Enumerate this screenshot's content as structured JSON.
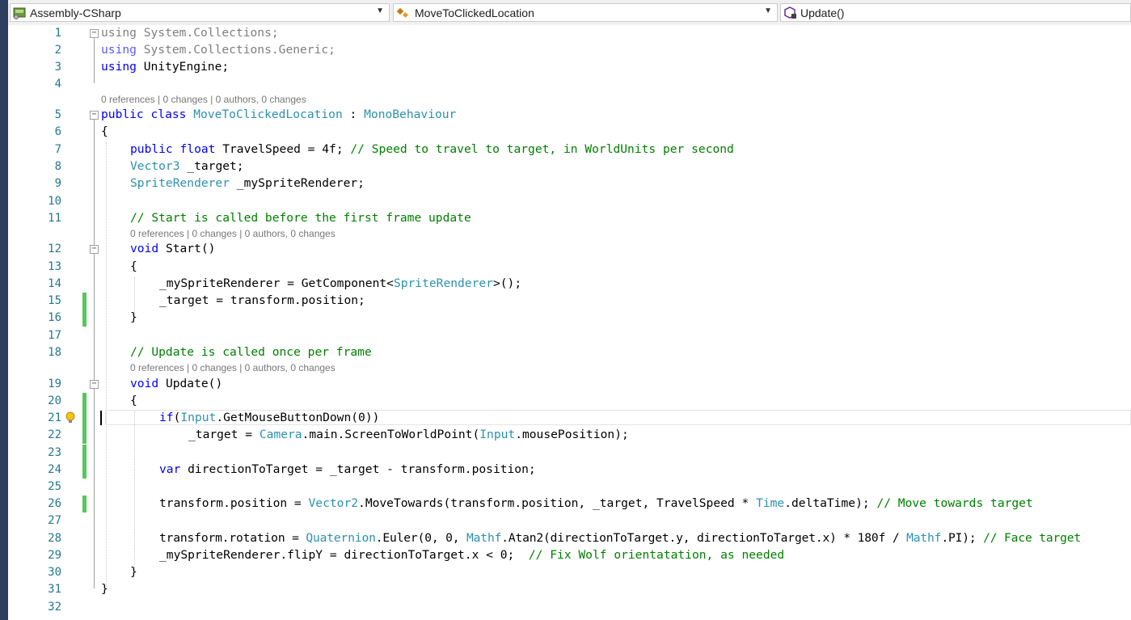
{
  "nav": {
    "project": "Assembly-CSharp",
    "type": "MoveToClickedLocation",
    "member": "Update()"
  },
  "lens": {
    "class": "0 references | 0 changes | 0 authors, 0 changes",
    "start": "0 references | 0 changes | 0 authors, 0 changes",
    "update": "0 references | 0 changes | 0 authors, 0 changes"
  },
  "line_numbers": [
    "1",
    "2",
    "3",
    "4",
    "5",
    "6",
    "7",
    "8",
    "9",
    "10",
    "11",
    "12",
    "13",
    "14",
    "15",
    "16",
    "17",
    "18",
    "19",
    "20",
    "21",
    "22",
    "23",
    "24",
    "25",
    "26",
    "27",
    "28",
    "29",
    "30",
    "31",
    "32"
  ],
  "code": {
    "l1": [
      "using",
      " System.Collections;"
    ],
    "l2": [
      "using",
      " System.Collections.Generic;"
    ],
    "l3": [
      "using",
      " UnityEngine;"
    ],
    "l5": [
      "public",
      " ",
      "class",
      " ",
      "MoveToClickedLocation",
      " : ",
      "MonoBehaviour"
    ],
    "l6": "{",
    "l7": [
      "public",
      " ",
      "float",
      " TravelSpeed = 4f; ",
      "// Speed to travel to target, in WorldUnits per second"
    ],
    "l8": [
      "Vector3",
      " _target;"
    ],
    "l9": [
      "SpriteRenderer",
      " _mySpriteRenderer;"
    ],
    "l11": "// Start is called before the first frame update",
    "l12": [
      "void",
      " Start()"
    ],
    "l13": "{",
    "l14": [
      "_mySpriteRenderer = GetComponent<",
      "SpriteRenderer",
      ">();"
    ],
    "l15": "_target = transform.position;",
    "l16": "}",
    "l18": "// Update is called once per frame",
    "l19": [
      "void",
      " Update()"
    ],
    "l20": "{",
    "l21": [
      "if",
      "(",
      "Input",
      ".GetMouseButtonDown(0))"
    ],
    "l22": [
      "_target = ",
      "Camera",
      ".main.ScreenToWorldPoint(",
      "Input",
      ".mousePosition);"
    ],
    "l24": [
      "var",
      " directionToTarget = _target - transform.position;"
    ],
    "l26": [
      "transform.position = ",
      "Vector2",
      ".MoveTowards(transform.position, _target, TravelSpeed * ",
      "Time",
      ".deltaTime); ",
      "// Move towards target"
    ],
    "l28": [
      "transform.rotation = ",
      "Quaternion",
      ".Euler(0, 0, ",
      "Mathf",
      ".Atan2(directionToTarget.y, directionToTarget.x) * 180f / ",
      "Mathf",
      ".PI); ",
      "// Face target"
    ],
    "l29": [
      "_mySpriteRenderer.flipY = directionToTarget.x < 0;  ",
      "// Fix Wolf orientatation, as needed"
    ],
    "l30": "}",
    "l31": "}"
  },
  "colors": {
    "keyword": "#0000ff",
    "type": "#2b91af",
    "comment": "#008000",
    "linenum": "#237893",
    "changebar": "#57c75a",
    "lens": "#777777"
  }
}
